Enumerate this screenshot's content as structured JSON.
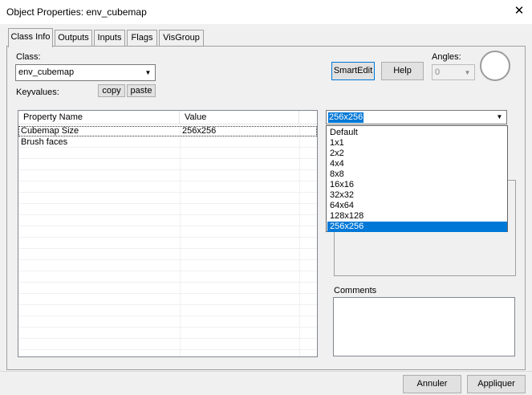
{
  "window": {
    "title": "Object Properties: env_cubemap",
    "close_glyph": "✕"
  },
  "tabs": [
    {
      "label": "Class Info",
      "active": true
    },
    {
      "label": "Outputs"
    },
    {
      "label": "Inputs"
    },
    {
      "label": "Flags"
    },
    {
      "label": "VisGroup"
    }
  ],
  "class_info": {
    "class_label": "Class:",
    "class_value": "env_cubemap",
    "keyvalues_label": "Keyvalues:",
    "copy_label": "copy",
    "paste_label": "paste",
    "smartedit_label": "SmartEdit",
    "help_label": "Help",
    "angles_label": "Angles:",
    "angles_value": "0"
  },
  "property_grid": {
    "headers": [
      "Property Name",
      "Value"
    ],
    "rows": [
      {
        "name": "Cubemap Size",
        "value": "256x256",
        "selected": true
      },
      {
        "name": "Brush faces",
        "value": ""
      }
    ]
  },
  "value_dropdown": {
    "selected": "256x256",
    "options": [
      "Default",
      "1x1",
      "2x2",
      "4x4",
      "8x8",
      "16x16",
      "32x32",
      "64x64",
      "128x128",
      "256x256"
    ]
  },
  "comments": {
    "label": "Comments",
    "text": ""
  },
  "footer": {
    "cancel_label": "Annuler",
    "apply_label": "Appliquer"
  }
}
